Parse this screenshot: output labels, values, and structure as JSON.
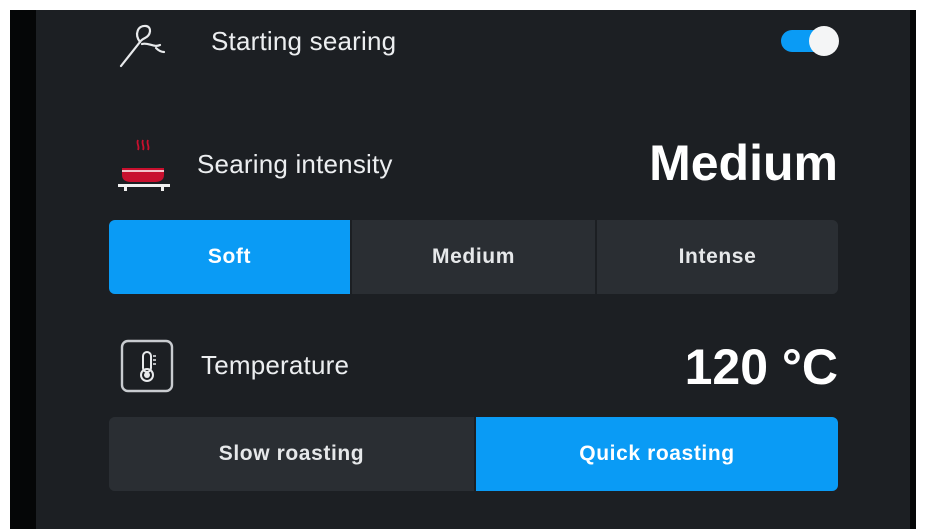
{
  "starting_searing": {
    "label": "Starting searing",
    "enabled": true
  },
  "searing_intensity": {
    "label": "Searing intensity",
    "value": "Medium",
    "options": [
      "Soft",
      "Medium",
      "Intense"
    ],
    "selected": "Soft"
  },
  "temperature": {
    "label": "Temperature",
    "value": "120 °C",
    "options": [
      "Slow roasting",
      "Quick roasting"
    ],
    "selected": "Quick roasting"
  },
  "icons": {
    "searing": "probe-icon",
    "intensity": "searing-pan-icon",
    "temperature": "thermometer-icon"
  },
  "colors": {
    "accent": "#0a9bf5",
    "background": "#1c1f23",
    "segment": "#2a2e33",
    "heat": "#c8102e"
  }
}
